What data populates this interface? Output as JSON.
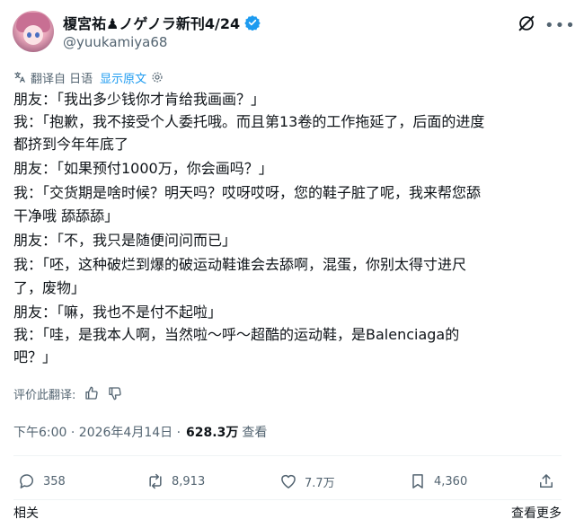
{
  "author": {
    "display_name": "榎宮祐♟ノゲノラ新刊4/24",
    "handle": "@yuukamiya68"
  },
  "translation": {
    "label": "翻译自 日语",
    "show_original": "显示原文"
  },
  "post_lines": [
    "朋友：「我出多少钱你才肯给我画画？」",
    "我：「抱歉，我不接受个人委托哦。而且第13卷的工作拖延了，后面的进度",
    "都挤到今年年底了",
    "朋友：「如果预付1000万，你会画吗？」",
    "我：「交货期是啥时候？明天吗？哎呀哎呀，您的鞋子脏了呢，我来帮您舔",
    "干净哦 舔舔舔」",
    "朋友：「不，我只是随便问问而已」",
    "我：「呸，这种破烂到爆的破运动鞋谁会去舔啊，混蛋，你别太得寸进尺",
    "了，废物」",
    "朋友：「嘛，我也不是付不起啦」",
    "我：「哇，是我本人啊，当然啦～呼～超酷的运动鞋，是Balenciaga的",
    "吧？」"
  ],
  "rate_translation": "评价此翻译:",
  "meta": {
    "timestamp": "下午6:00 · 2026年4月14日 ·",
    "views_count": "628.3万",
    "views_label": "查看"
  },
  "actions": {
    "replies": "358",
    "reposts": "8,913",
    "likes": "7.7万",
    "bookmarks": "4,360"
  },
  "bottom": {
    "related": "相关",
    "view_more": "查看更多"
  },
  "colors": {
    "accent": "#1d9bf0",
    "text": "#0f1419",
    "secondary": "#536471"
  }
}
